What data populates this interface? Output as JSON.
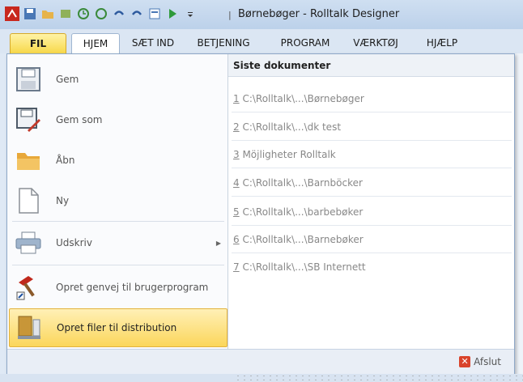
{
  "window": {
    "title": "Børnebøger - Rolltalk Designer"
  },
  "tabs": [
    {
      "label": "FIL"
    },
    {
      "label": "HJEM"
    },
    {
      "label": "SÆT IND"
    },
    {
      "label": "BETJENING"
    },
    {
      "label": "PROGRAM"
    },
    {
      "label": "VÆRKTØJ"
    },
    {
      "label": "HJÆLP"
    }
  ],
  "menu": {
    "items": [
      {
        "label": "Gem",
        "icon": "save-icon"
      },
      {
        "label": "Gem som",
        "icon": "save-as-icon"
      },
      {
        "label": "Åbn",
        "icon": "folder-icon"
      },
      {
        "label": "Ny",
        "icon": "new-document-icon"
      },
      {
        "label": "Udskriv",
        "icon": "printer-icon"
      },
      {
        "label": "Opret genvej til brugerprogram",
        "icon": "hammer-shortcut-icon"
      },
      {
        "label": "Opret filer til distribution",
        "icon": "distribution-icon"
      }
    ],
    "recent_header": "Siste dokumenter",
    "recent": [
      {
        "num": "1",
        "path": " C:\\Rolltalk\\...\\Børnebøger"
      },
      {
        "num": "2",
        "path": " C:\\Rolltalk\\...\\dk test"
      },
      {
        "num": "3",
        "path": " Möjligheter Rolltalk"
      },
      {
        "num": "4",
        "path": " C:\\Rolltalk\\...\\Barnböcker"
      },
      {
        "num": "5",
        "path": " C:\\Rolltalk\\...\\barbebøker"
      },
      {
        "num": "6",
        "path": " C:\\Rolltalk\\...\\Barnebøker"
      },
      {
        "num": "7",
        "path": " C:\\Rolltalk\\...\\SB Internett"
      }
    ],
    "exit_label": "Afslut"
  },
  "colors": {
    "active_item": "#fbd65b",
    "accent": "#d9432b"
  }
}
